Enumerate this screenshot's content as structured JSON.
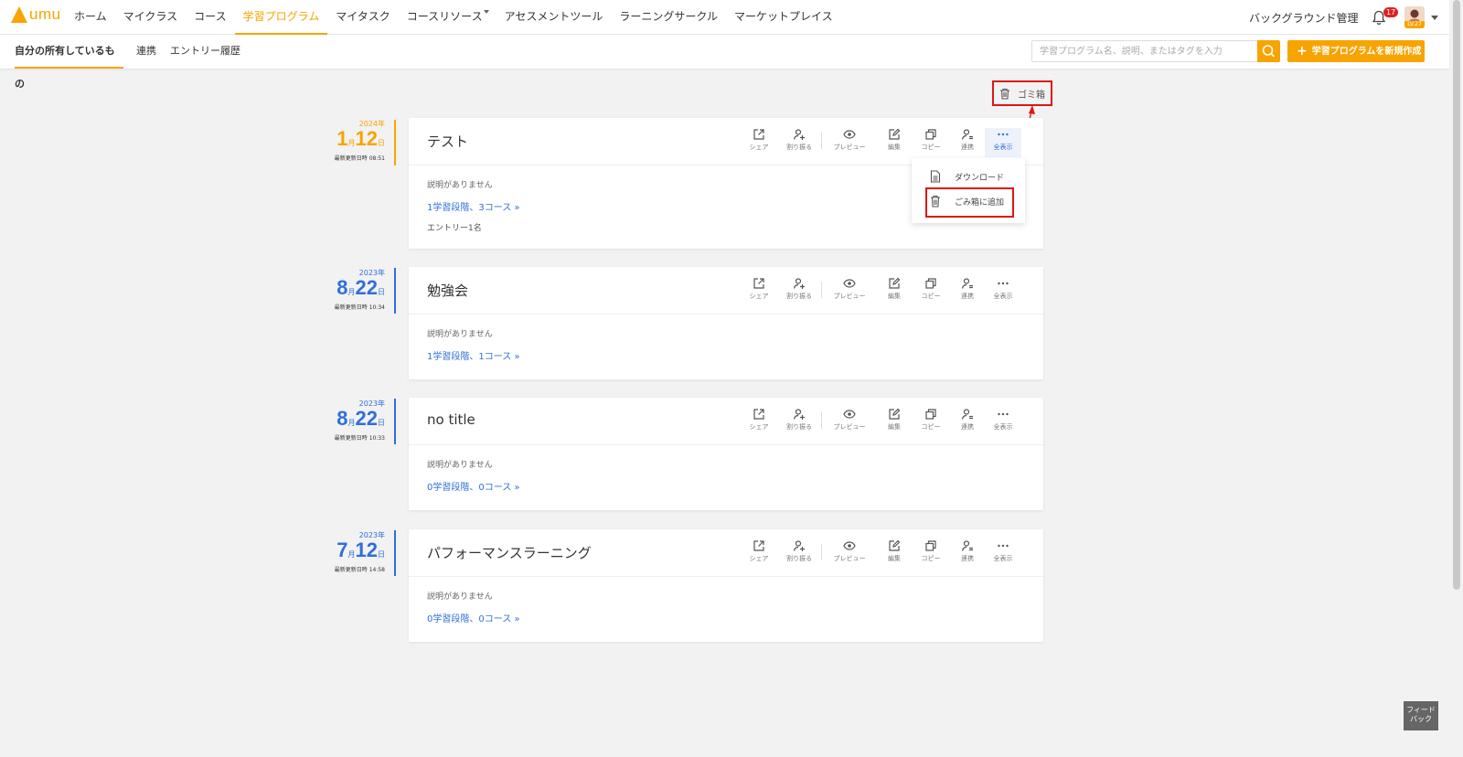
{
  "app": {
    "logo_text": "umu"
  },
  "nav": {
    "items": [
      {
        "label": "ホーム"
      },
      {
        "label": "マイクラス"
      },
      {
        "label": "コース"
      },
      {
        "label": "学習プログラム",
        "active": true
      },
      {
        "label": "マイタスク"
      },
      {
        "label": "コースリソース",
        "has_caret": true
      },
      {
        "label": "アセスメントツール"
      },
      {
        "label": "ラーニングサークル"
      },
      {
        "label": "マーケットプレイス"
      }
    ],
    "background_admin": "バックグラウンド管理",
    "notification_count": "17",
    "avatar_level": "LV.27"
  },
  "subnav": {
    "tabs": [
      {
        "label": "自分の所有しているもの",
        "active": true
      },
      {
        "label": "連携"
      },
      {
        "label": "エントリー履歴"
      }
    ],
    "search_placeholder": "学習プログラム名、説明、またはタグを入力",
    "create_label": "学習プログラムを新規作成"
  },
  "trash_label": "ゴミ箱",
  "actions": [
    "シェア",
    "割り振る",
    "プレビュー",
    "編集",
    "コピー",
    "連携",
    "全表示"
  ],
  "dropdown": {
    "download": "ダウンロード",
    "add_to_trash": "ごみ箱に追加"
  },
  "programs": [
    {
      "year": "2024年",
      "month": "1",
      "month_unit": "月",
      "day": "12",
      "day_unit": "日",
      "updated": "最新更新日時 08:51",
      "color": "#f7a400",
      "title": "テスト",
      "desc": "説明がありません",
      "summary": "1学習段階、3コース »",
      "entries": "エントリー1名"
    },
    {
      "year": "2023年",
      "month": "8",
      "month_unit": "月",
      "day": "22",
      "day_unit": "日",
      "updated": "最新更新日時 10:34",
      "color": "#2f6fdb",
      "title": "勉強会",
      "desc": "説明がありません",
      "summary": "1学習段階、1コース »"
    },
    {
      "year": "2023年",
      "month": "8",
      "month_unit": "月",
      "day": "22",
      "day_unit": "日",
      "updated": "最新更新日時 10:33",
      "color": "#2f6fdb",
      "title": "no title",
      "desc": "説明がありません",
      "summary": "0学習段階、0コース »"
    },
    {
      "year": "2023年",
      "month": "7",
      "month_unit": "月",
      "day": "12",
      "day_unit": "日",
      "updated": "最新更新日時 14:58",
      "color": "#2f6fdb",
      "title": "パフォーマンスラーニング",
      "desc": "説明がありません",
      "summary": "0学習段階、0コース »"
    }
  ],
  "feedback": "フィードバック",
  "icons": {
    "share": "share-icon",
    "assign": "assign-user-icon",
    "preview": "eye-icon",
    "edit": "edit-icon",
    "copy": "copy-icon",
    "link": "link-user-icon",
    "more": "ellipsis-icon",
    "trash": "trash-icon",
    "download": "document-icon",
    "search": "search-icon",
    "bell": "bell-icon"
  },
  "colors": {
    "accent": "#f7a400",
    "link": "#2f6fdb",
    "highlight": "#e01515"
  }
}
